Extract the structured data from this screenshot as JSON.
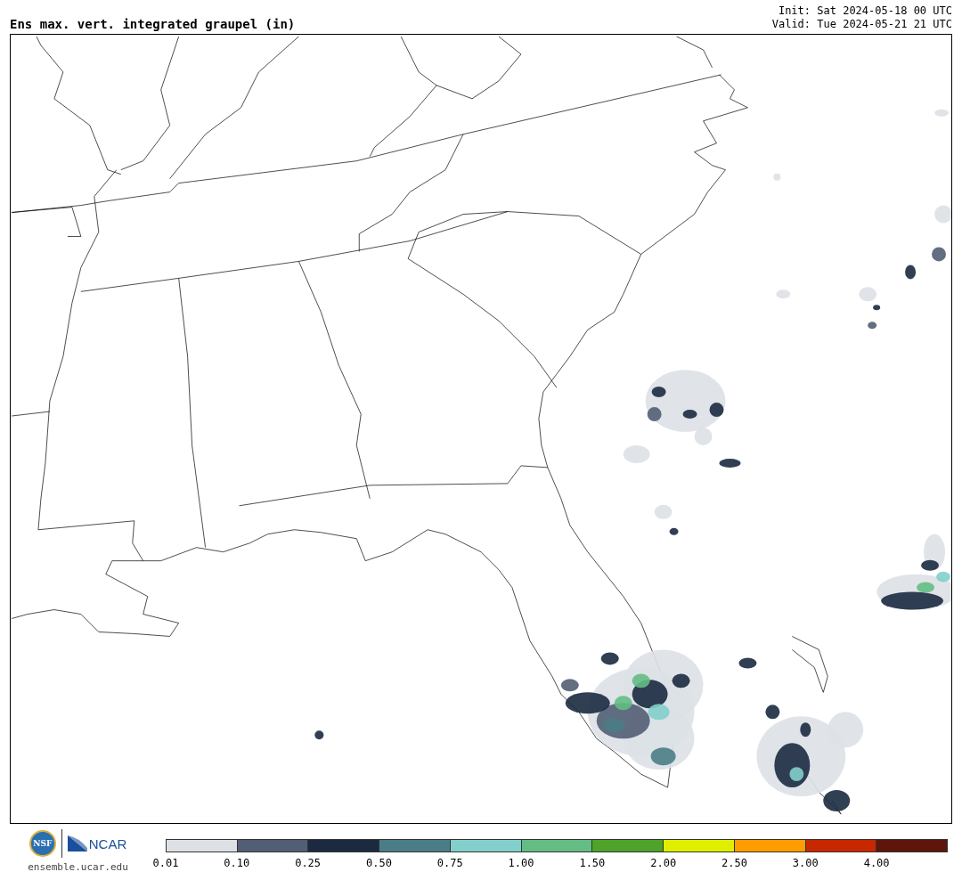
{
  "title": "Ens max. vert. integrated graupel (in)",
  "init": "Init: Sat 2024-05-18 00 UTC",
  "valid": "Valid: Tue 2024-05-21 21 UTC",
  "logo": {
    "nsf": "NSF",
    "ncar": "NCAR",
    "url": "ensemble.ucar.edu"
  },
  "colorbar": [
    {
      "label": "0.01",
      "color": "#dde1e6"
    },
    {
      "label": "0.10",
      "color": "#525e73"
    },
    {
      "label": "0.25",
      "color": "#1b2a40"
    },
    {
      "label": "0.50",
      "color": "#4a7d86"
    },
    {
      "label": "0.75",
      "color": "#82cfcb"
    },
    {
      "label": "1.00",
      "color": "#63bd84"
    },
    {
      "label": "1.50",
      "color": "#4fa22a"
    },
    {
      "label": "2.00",
      "color": "#e0ef00"
    },
    {
      "label": "2.50",
      "color": "#ff9c00"
    },
    {
      "label": "3.00",
      "color": "#c82800"
    },
    {
      "label": "4.00",
      "color": "#5e160c"
    }
  ]
}
